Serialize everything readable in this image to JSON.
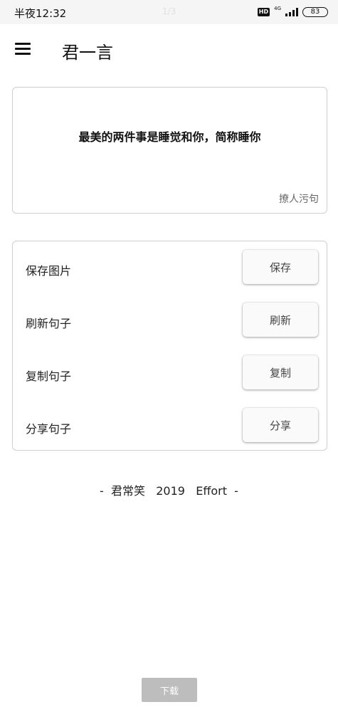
{
  "status_bar": {
    "time": "半夜12:32",
    "center_text": "1/3",
    "hd": "HD",
    "network": "4G",
    "battery": "83"
  },
  "header": {
    "menu_icon": "hamburger-menu-icon",
    "title": "君一言"
  },
  "quote": {
    "text": "最美的两件事是睡觉和你，简称睡你",
    "category": "撩人污句"
  },
  "actions": [
    {
      "label": "保存图片",
      "button": "保存"
    },
    {
      "label": "刷新句子",
      "button": "刷新"
    },
    {
      "label": "复制句子",
      "button": "复制"
    },
    {
      "label": "分享句子",
      "button": "分享"
    }
  ],
  "footer": {
    "text": "-  君常笑   2019   Effort  -"
  },
  "download_button": "下载",
  "colors": {
    "card_border": "#cfcfcf",
    "button_bg": "#fafafa",
    "download_bg": "#bdbdbd"
  }
}
